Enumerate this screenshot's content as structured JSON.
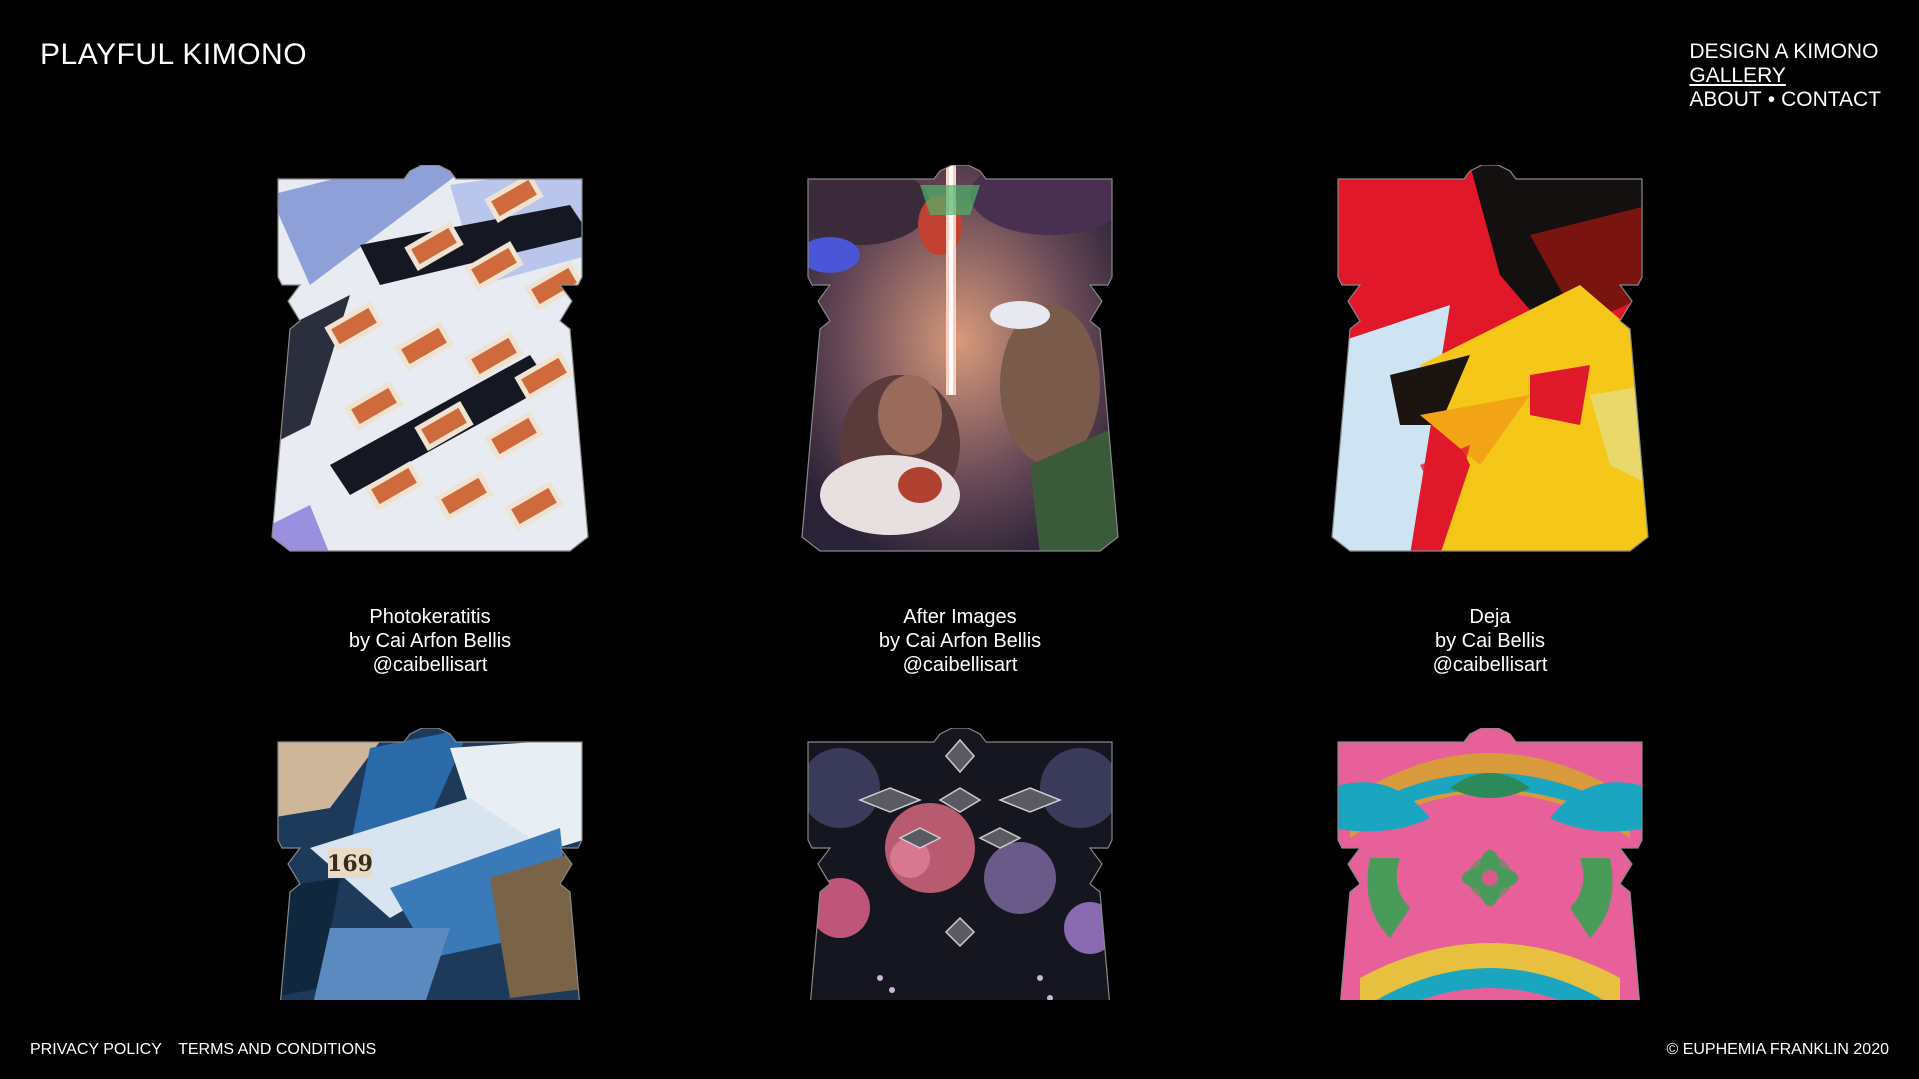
{
  "brand": "PLAYFUL KIMONO",
  "nav": {
    "design": "DESIGN A KIMONO",
    "gallery": "GALLERY",
    "about": "ABOUT",
    "separator": "•",
    "contact": "CONTACT"
  },
  "gallery": [
    {
      "title": "Photokeratitis",
      "artist": "by Cai Arfon Bellis",
      "handle": "@caibellisart"
    },
    {
      "title": "After Images",
      "artist": "by Cai Arfon Bellis",
      "handle": "@caibellisart"
    },
    {
      "title": "Deja",
      "artist": "by Cai Bellis",
      "handle": "@caibellisart"
    },
    {
      "title": "",
      "artist": "",
      "handle": ""
    },
    {
      "title": "",
      "artist": "",
      "handle": ""
    },
    {
      "title": "",
      "artist": "",
      "handle": ""
    }
  ],
  "artwork_labels": {
    "item4_number": "169"
  },
  "footer": {
    "privacy": "PRIVACY POLICY",
    "terms": "TERMS AND CONDITIONS",
    "copyright": "© EUPHEMIA FRANKLIN 2020"
  },
  "colors": {
    "background": "#000000",
    "text": "#ffffff"
  }
}
